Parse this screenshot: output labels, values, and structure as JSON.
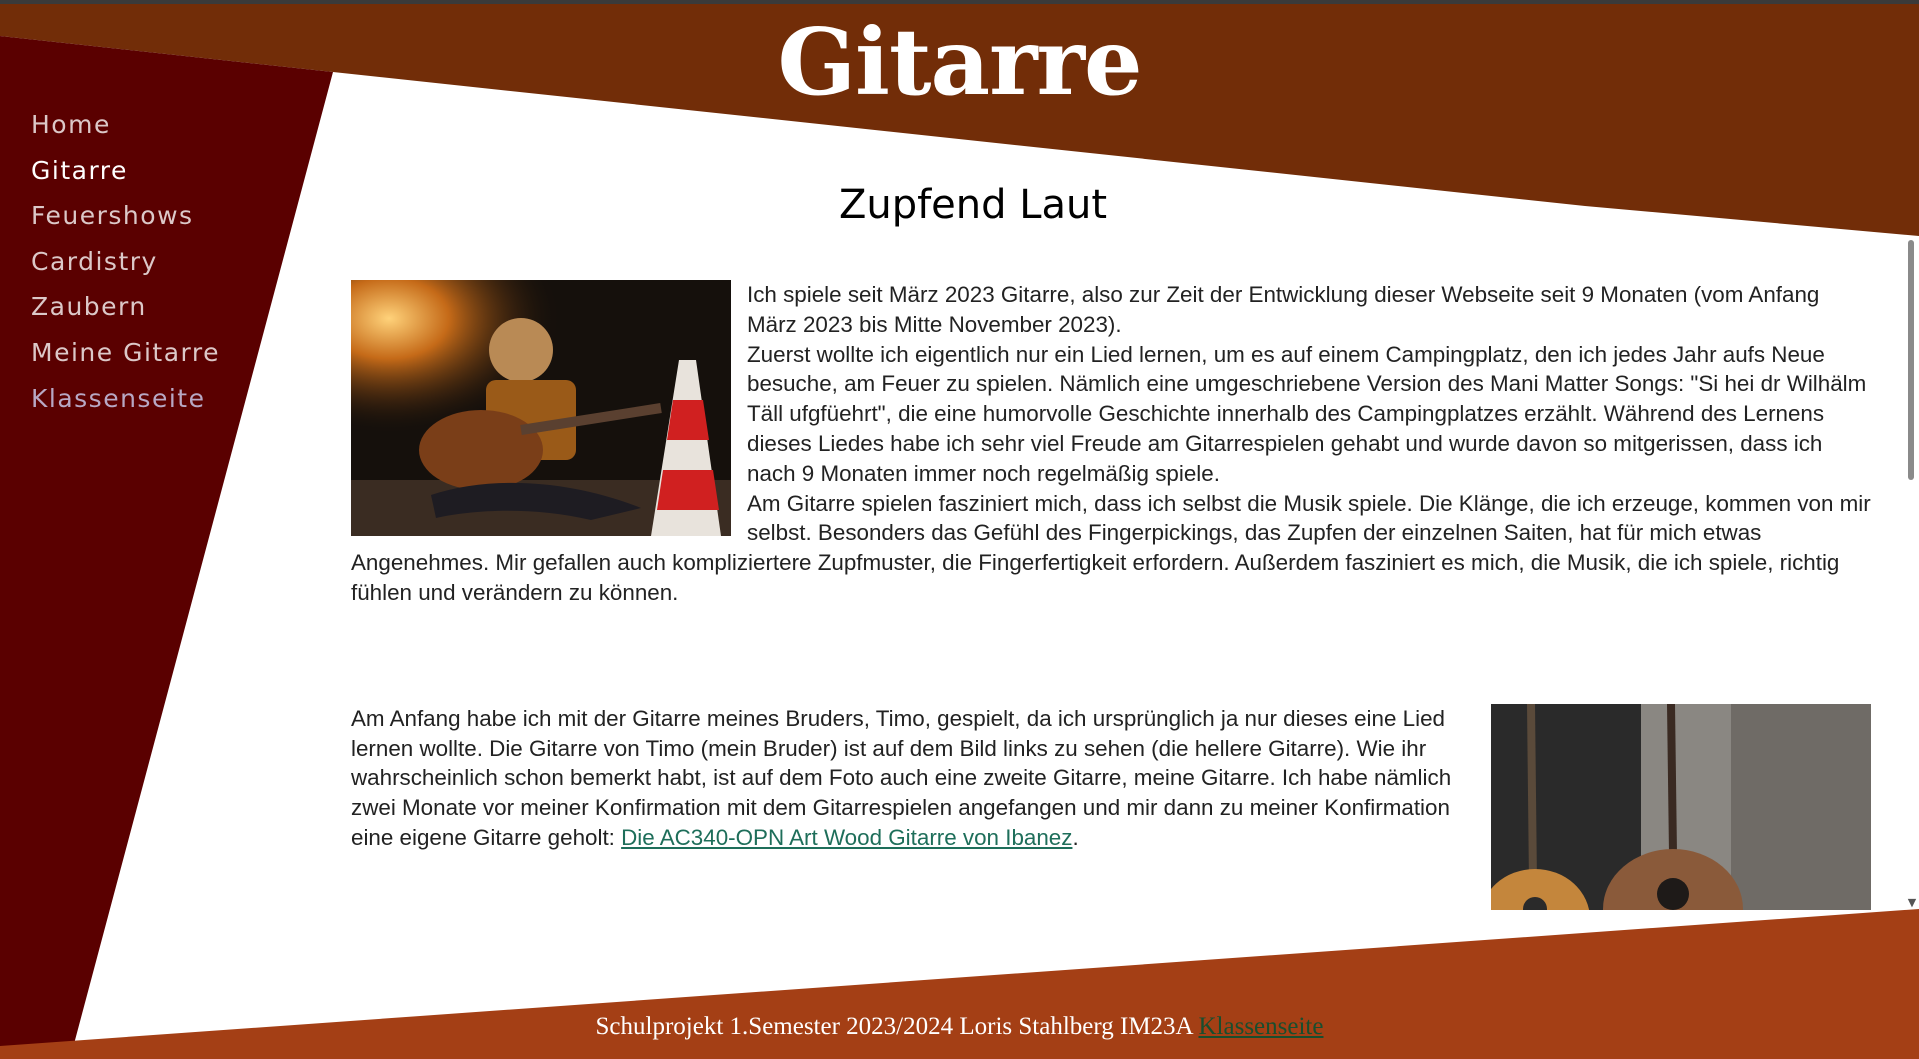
{
  "colors": {
    "header_brown": "#722D08",
    "sidebar_dark_red": "#5A0000",
    "footer_orange": "#A43F15",
    "link_green": "#1E6E5A"
  },
  "header": {
    "title": "Gitarre"
  },
  "nav": {
    "items": [
      {
        "label": "Home"
      },
      {
        "label": "Gitarre"
      },
      {
        "label": "Feuershows"
      },
      {
        "label": "Cardistry"
      },
      {
        "label": "Zaubern"
      },
      {
        "label": "Meine Gitarre"
      },
      {
        "label": "Klassenseite"
      }
    ]
  },
  "main": {
    "heading": "Zupfend Laut",
    "section1": {
      "p1": "Ich spiele seit März 2023 Gitarre, also zur Zeit der Entwicklung dieser Webseite seit 9 Monaten (vom Anfang März 2023 bis Mitte November 2023).",
      "p2": "Zuerst wollte ich eigentlich nur ein Lied lernen, um es auf einem Campingplatz, den ich jedes Jahr aufs Neue besuche, am Feuer zu spielen. Nämlich eine umgeschriebene Version des Mani Matter Songs: \"Si hei dr Wilhälm Täll ufgfüehrt\", die eine humorvolle Geschichte innerhalb des Campingplatzes erzählt. Während des Lernens dieses Liedes habe ich sehr viel Freude am Gitarrespielen gehabt und wurde davon so mitgerissen, dass ich nach 9 Monaten immer noch regelmäßig spiele.",
      "p3": "Am Gitarre spielen fasziniert mich, dass ich selbst die Musik spiele. Die Klänge, die ich erzeuge, kommen von mir selbst. Besonders das Gefühl des Fingerpickings, das Zupfen der einzelnen Saiten, hat für mich etwas Angenehmes. Mir gefallen auch kompliziertere Zupfmuster, die Fingerfertigkeit erfordern. Außerdem fasziniert es mich, die Musik, die ich spiele, richtig fühlen und verändern zu können."
    },
    "section2": {
      "p1_text": "Am Anfang habe ich mit der Gitarre meines Bruders, Timo, gespielt, da ich ursprünglich ja nur dieses eine Lied lernen wollte. Die Gitarre von Timo (mein Bruder) ist auf dem Bild links zu sehen (die hellere Gitarre). Wie ihr wahrscheinlich schon bemerkt habt, ist auf dem Foto auch eine zweite Gitarre, meine Gitarre. Ich habe nämlich zwei Monate vor meiner Konfirmation mit dem Gitarrespielen angefangen und mir dann zu meiner Konfirmation eine eigene Gitarre geholt: ",
      "p1_link": "Die AC340-OPN Art Wood Gitarre von Ibanez",
      "p1_end": "."
    }
  },
  "footer": {
    "text": "Schulprojekt 1.Semester 2023/2024 Loris Stahlberg IM23A ",
    "link": "Klassenseite"
  },
  "icons": {
    "scroll_down": "scroll-down-arrow-icon"
  }
}
